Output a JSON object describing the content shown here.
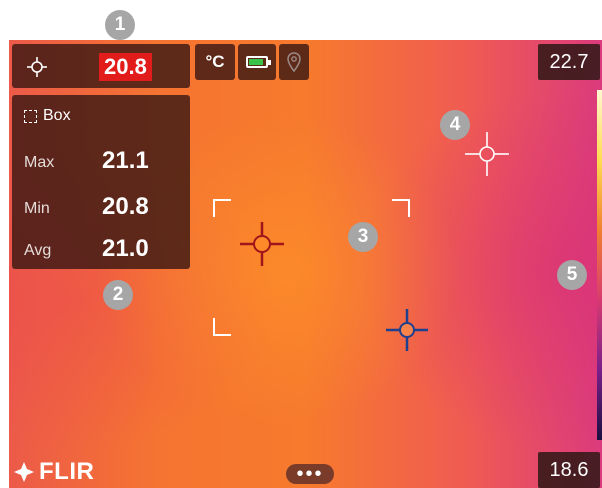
{
  "callouts": [
    "1",
    "2",
    "3",
    "4",
    "5"
  ],
  "spot": {
    "value": "20.8",
    "icon": "crosshair-icon"
  },
  "status": {
    "unit": "°C",
    "battery": "battery-icon",
    "gps": "location-pin-icon"
  },
  "measurement": {
    "title": "Box",
    "rows": [
      {
        "label": "Max",
        "value": "21.1"
      },
      {
        "label": "Min",
        "value": "20.8"
      },
      {
        "label": "Avg",
        "value": "21.0"
      }
    ]
  },
  "scale": {
    "max": "22.7",
    "min": "18.6"
  },
  "brand": "FLIR",
  "menu": {
    "label": "•••"
  },
  "colors": {
    "spot_highlight": "#e21b1b",
    "hot_marker": "#a0151a",
    "cold_marker": "#1f3f8f",
    "battery": "#39c24a"
  }
}
